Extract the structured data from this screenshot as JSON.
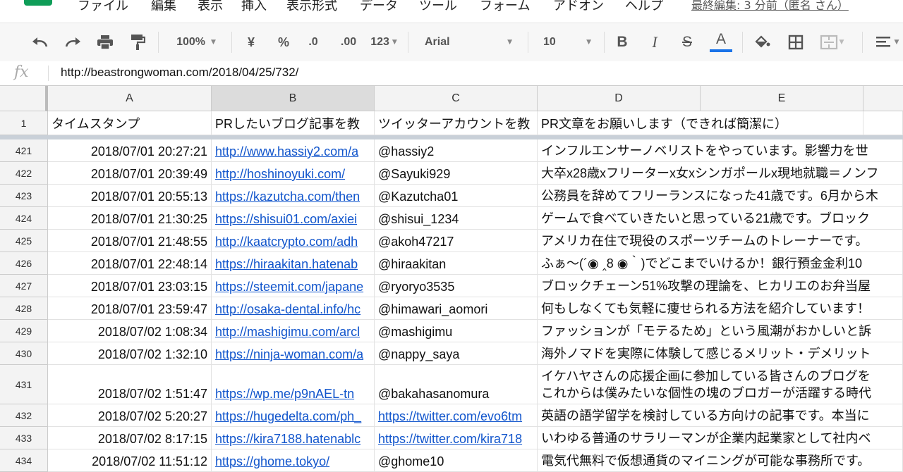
{
  "menu": {
    "items": [
      "ファイル",
      "編集",
      "表示",
      "挿入",
      "表示形式",
      "データ",
      "ツール",
      "フォーム",
      "アドオン",
      "ヘルプ"
    ],
    "last_edit": "最終編集: 3 分前（匿名 さん）"
  },
  "toolbar": {
    "zoom": "100%",
    "currency": "¥",
    "percent": "%",
    "decimal_decrease": ".0",
    "decimal_increase": ".00",
    "number_format": "123",
    "font": "Arial",
    "font_size": "10",
    "bold": "B",
    "italic": "I",
    "strike": "S",
    "text_color": "A",
    "text_color_hex": "#1a73e8"
  },
  "formula_bar": {
    "fx": "fx",
    "value": "http://beastrongwoman.com/2018/04/25/732/"
  },
  "columns": [
    "A",
    "B",
    "C",
    "D",
    "E"
  ],
  "header_row": {
    "number": "1",
    "a": "タイムスタンプ",
    "b": "PRしたいブログ記事を教",
    "c": "ツイッターアカウントを教",
    "d": "PR文章をお願いします（できれば簡潔に）"
  },
  "rows": [
    {
      "n": "421",
      "a": "2018/07/01 20:27:21",
      "b": "http://www.hassiy2.com/a",
      "c": "@hassiy2",
      "d": "インフルエンサーノベリストをやっています。影響力を世"
    },
    {
      "n": "422",
      "a": "2018/07/01 20:39:49",
      "b": "http://hoshinoyuki.com/",
      "c": "@Sayuki929",
      "d": "大卒x28歳xフリーターx女xシンガポールx現地就職＝ノンフ"
    },
    {
      "n": "423",
      "a": "2018/07/01 20:55:13",
      "b": "https://kazutcha.com/then",
      "c": "@Kazutcha01",
      "d": "公務員を辞めてフリーランスになった41歳です。6月から木"
    },
    {
      "n": "424",
      "a": "2018/07/01 21:30:25",
      "b": "https://shisui01.com/axiei",
      "c": "@shisui_1234",
      "d": "ゲームで食べていきたいと思っている21歳です。ブロック"
    },
    {
      "n": "425",
      "a": "2018/07/01 21:48:55",
      "b": "http://kaatcrypto.com/adh",
      "c": "@akoh47217",
      "d": "アメリカ在住で現役のスポーツチームのトレーナーです。"
    },
    {
      "n": "426",
      "a": "2018/07/01 22:48:14",
      "b": "https://hiraakitan.hatenab",
      "c": "@hiraakitan",
      "d": "ふぁ〜(´◉ ‸8 ◉｀)でどこまでいけるか！銀行預金金利10"
    },
    {
      "n": "427",
      "a": "2018/07/01 23:03:15",
      "b": "https://steemit.com/japane",
      "c": "@ryoryo3535",
      "d": "ブロックチェーン51%攻撃の理論を、ヒカリエのお弁当屋"
    },
    {
      "n": "428",
      "a": "2018/07/01 23:59:47",
      "b": "http://osaka-dental.info/hc",
      "c": "@himawari_aomori",
      "d": "何もしなくても気軽に痩せられる方法を紹介しています！"
    },
    {
      "n": "429",
      "a": "2018/07/02 1:08:34",
      "b": "http://mashigimu.com/arcl",
      "c": "@mashigimu",
      "d": "ファッションが「モテるため」という風潮がおかしいと訴"
    },
    {
      "n": "430",
      "a": "2018/07/02 1:32:10",
      "b": "https://ninja-woman.com/a",
      "c": "@nappy_saya",
      "d": "海外ノマドを実際に体験して感じるメリット・デメリット"
    },
    {
      "n": "431",
      "a": "2018/07/02 1:51:47",
      "b": "https://wp.me/p9nAEL-tn",
      "c": "@bakahasanomura",
      "d": "イケハヤさんの応援企画に参加している皆さんのブログを",
      "d2": "これからは僕みたいな個性の塊のブロガーが活躍する時代"
    },
    {
      "n": "432",
      "a": "2018/07/02 5:20:27",
      "b": "https://hugedelta.com/ph_",
      "c": "https://twitter.com/evo6tm",
      "d": "英語の語学留学を検討している方向けの記事です。本当に"
    },
    {
      "n": "433",
      "a": "2018/07/02 8:17:15",
      "b": "https://kira7188.hatenablc",
      "c": "https://twitter.com/kira718",
      "d": "いわゆる普通のサラリーマンが企業内起業家として社内ベ"
    },
    {
      "n": "434",
      "a": "2018/07/02 11:51:12",
      "b": "https://ghome.tokyo/",
      "c": "@ghome10",
      "d": "電気代無料で仮想通貨のマイニングが可能な事務所です。"
    }
  ]
}
